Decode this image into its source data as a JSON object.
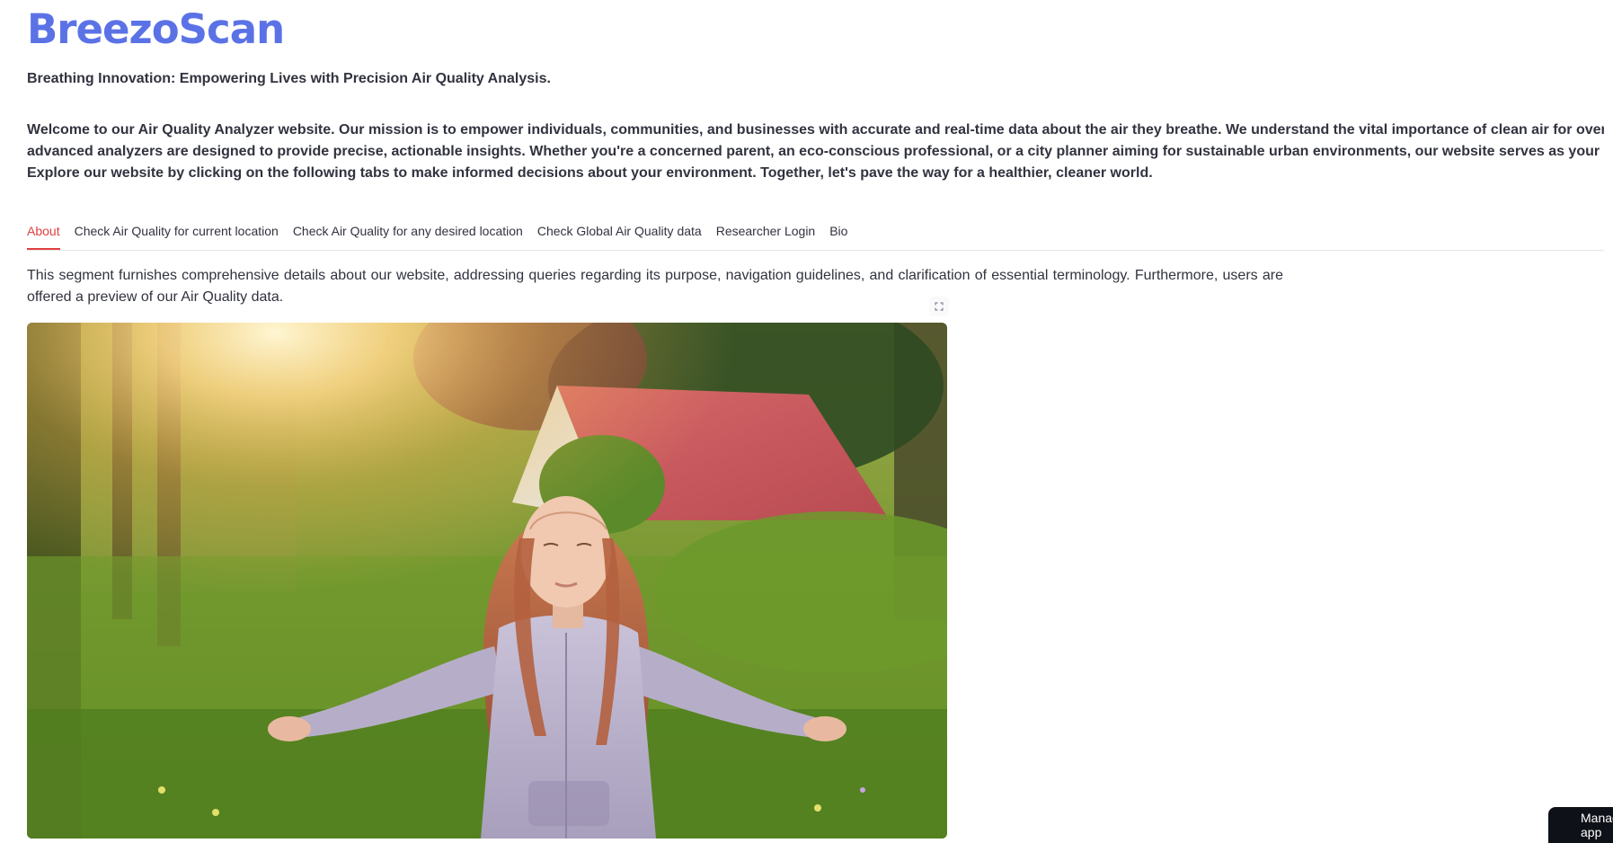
{
  "app": {
    "title": "BreezoScan",
    "tagline": "Breathing Innovation: Empowering Lives with Precision Air Quality Analysis.",
    "brand_color": "#5b72e6"
  },
  "welcome": {
    "lines": [
      "Welcome to our Air Quality Analyzer website. Our mission is to empower individuals, communities, and businesses with accurate and real-time data about the air they breathe. We understand the vital importance of clean air for overall well-being, and our",
      "advanced analyzers are designed to provide precise, actionable insights. Whether you're a concerned parent, an eco-conscious professional, or a city planner aiming for sustainable urban environments, our website serves as your comprehensive resource.",
      "Explore our website by clicking on the following tabs to make informed decisions about your environment. Together, let's pave the way for a healthier, cleaner world."
    ]
  },
  "tabs": [
    {
      "label": "About",
      "active": true
    },
    {
      "label": "Check Air Quality for current location",
      "active": false
    },
    {
      "label": "Check Air Quality for any desired location",
      "active": false
    },
    {
      "label": "Check Global Air Quality data",
      "active": false
    },
    {
      "label": "Researcher Login",
      "active": false
    },
    {
      "label": "Bio",
      "active": false
    }
  ],
  "about": {
    "text": "This segment furnishes comprehensive details about our website, addressing queries regarding its purpose, navigation guidelines, and clarification of essential terminology. Furthermore, users are offered a preview of our Air Quality data.",
    "image_icon": "fullscreen-icon"
  },
  "manage_app": {
    "label": "Manage app",
    "icon": "chevron-left-icon"
  },
  "colors": {
    "accent": "#e0403f",
    "text": "#31333f"
  }
}
